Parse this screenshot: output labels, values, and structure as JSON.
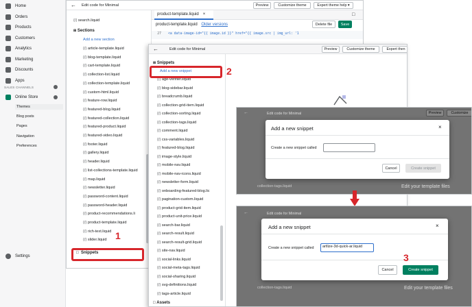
{
  "nav": {
    "items": [
      "Home",
      "Orders",
      "Products",
      "Customers",
      "Analytics",
      "Marketing",
      "Discounts",
      "Apps"
    ],
    "sales_channels_label": "SALES CHANNELS",
    "online_store": "Online Store",
    "sub_items": [
      "Themes",
      "Blog posts",
      "Pages",
      "Navigation",
      "Preferences"
    ],
    "settings": "Settings"
  },
  "panel1": {
    "title": "Edit code for Minimal",
    "preview": "Preview",
    "customize": "Customize theme",
    "expert": "Expert theme help",
    "search_file": "search.liquid",
    "sections_label": "Sections",
    "add_section": "Add a new section",
    "files": [
      "article-template.liquid",
      "blog-template.liquid",
      "cart-template.liquid",
      "collection-list.liquid",
      "collection-template.liquid",
      "custom-html.liquid",
      "feature-row.liquid",
      "featured-blog.liquid",
      "featured-collection.liquid",
      "featured-product.liquid",
      "featured-video.liquid",
      "footer.liquid",
      "gallery.liquid",
      "header.liquid",
      "list-collections-template.liquid",
      "map.liquid",
      "newsletter.liquid",
      "password-content.liquid",
      "password-header.liquid",
      "product-recommendations.li",
      "product-template.liquid",
      "rich-text.liquid",
      "slider.liquid"
    ],
    "snippets_label": "Snippets",
    "tab_file": "product-template.liquid",
    "editor_file": "product-template.liquid",
    "older_versions": "Older versions",
    "delete_file": "Delete file",
    "save": "Save",
    "code_line": "<a data-image-id=\"{{ image.id }}\" href=\"{{ image.src | img_url: '1",
    "line_no": "27"
  },
  "panel2": {
    "title": "Edit code for Minimal",
    "preview": "Preview",
    "customize": "Customize theme",
    "expert": "Expert then",
    "snippets_label": "Snippets",
    "add_snippet": "Add a new snippet",
    "files": [
      "age-verifier.liquid",
      "blog-sidebar.liquid",
      "breadcrumb.liquid",
      "collection-grid-item.liquid",
      "collection-sorting.liquid",
      "collection-tags.liquid",
      "comment.liquid",
      "css-variables.liquid",
      "featured-blog.liquid",
      "image-style.liquid",
      "mobile-nav.liquid",
      "mobile-nav-icons.liquid",
      "newsletter-form.liquid",
      "onboarding-featured-blog.lic",
      "pagination-custom.liquid",
      "product-grid-item.liquid",
      "product-unit-price.liquid",
      "search-bar.liquid",
      "search-result.liquid",
      "search-result-grid.liquid",
      "site-nav.liquid",
      "social-links.liquid",
      "social-meta-tags.liquid",
      "social-sharing.liquid",
      "svg-definitions.liquid",
      "tags-article.liquid"
    ],
    "assets_label": "Assets"
  },
  "panel3": {
    "title": "Edit code for Minimal",
    "preview": "Preview",
    "customize": "Customize",
    "modal_title": "Add a new snippet",
    "field_label": "Create a new snippet called",
    "input_value": "",
    "cancel": "Cancel",
    "create": "Create snippet",
    "bg_files": [
      "collection-tags.liquid"
    ],
    "edit_files": "Edit your template files"
  },
  "panel4": {
    "title": "Edit code for Minimal",
    "modal_title": "Add a new snippet",
    "field_label": "Create a new snippet called",
    "input_value": "artlize-3d-quick-ar.liquid",
    "cancel": "Cancel",
    "create": "Create snippet",
    "bg_files": [
      "collection-tags.liquid"
    ],
    "edit_files": "Edit your template files"
  },
  "steps": [
    "1",
    "2",
    "3"
  ],
  "colors": {
    "accent_red": "#d7262b",
    "save_green": "#008060",
    "link_blue": "#2c6ecb"
  }
}
